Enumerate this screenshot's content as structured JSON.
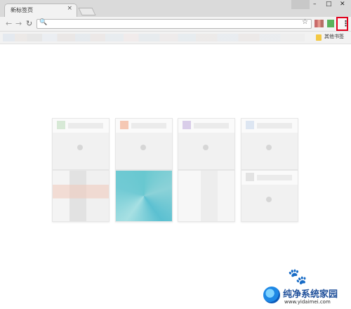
{
  "browser": {
    "tab": {
      "title": "新标签页",
      "close_glyph": "×"
    },
    "window_controls": {
      "minimize": "–",
      "maximize": "□",
      "close": "✕"
    },
    "toolbar": {
      "back_glyph": "←",
      "forward_glyph": "→",
      "reload_glyph": "↻",
      "search_glyph": "🔍",
      "star_glyph": "☆",
      "omnibox_value": "",
      "menu_glyph": "⋮",
      "menu_highlight_color": "#e1001b"
    },
    "bookmarks_bar": {
      "other_bookmarks_label": "其他书签",
      "folder_color": "#f3c844"
    }
  },
  "tiles": [
    {
      "name": "tile-1",
      "favicon_color": "#d7e9d6"
    },
    {
      "name": "tile-2",
      "favicon_color": "#f5c8b4"
    },
    {
      "name": "tile-3",
      "favicon_color": "#d9cde9"
    },
    {
      "name": "tile-4",
      "favicon_color": "#dde6f2"
    },
    {
      "name": "tile-5",
      "favicon_color": "#dddddd"
    },
    {
      "name": "tile-6",
      "favicon_color": "#6ec9d6"
    },
    {
      "name": "tile-7",
      "favicon_color": "#eaeaea"
    },
    {
      "name": "tile-8",
      "favicon_color": "#e3e3e3"
    }
  ],
  "watermark": {
    "ghost_glyph": "🐾",
    "brand": "纯净系统家园",
    "url": "www.yidaimei.com"
  }
}
